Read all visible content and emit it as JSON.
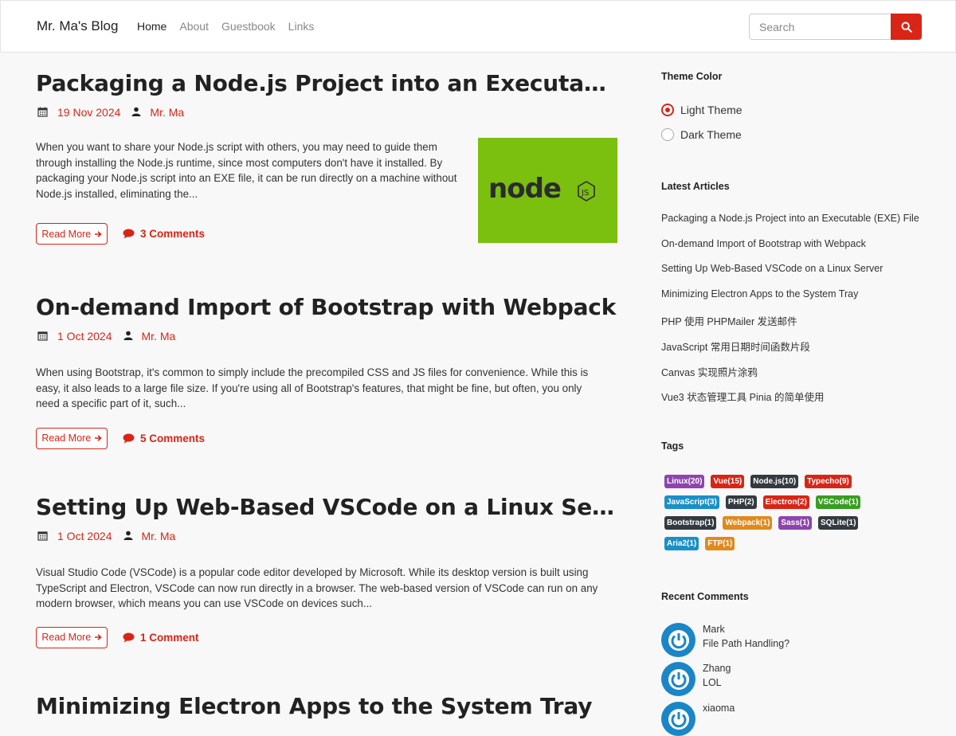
{
  "nav": {
    "brand": "Mr. Ma's Blog",
    "links": [
      "Home",
      "About",
      "Guestbook",
      "Links"
    ],
    "search_placeholder": "Search"
  },
  "articles": [
    {
      "title": "Packaging a Node.js Project into an Executable (EXE) File",
      "date": "19 Nov 2024",
      "author": "Mr. Ma",
      "excerpt": "When you want to share your Node.js script with others, you may need to guide them through installing the Node.js runtime, since most computers don't have it installed. By packaging your Node.js script into an EXE file, it can be run directly on a machine without Node.js installed, eliminating the...",
      "read_more": "Read More",
      "comments": "3 Comments",
      "thumbnail_text": "node",
      "thumbnail_badge": "JS"
    },
    {
      "title": "On-demand Import of Bootstrap with Webpack",
      "date": "1 Oct 2024",
      "author": "Mr. Ma",
      "excerpt": "When using Bootstrap, it's common to simply include the precompiled CSS and JS files for convenience. While this is easy, it also leads to a large file size. If you're using all of Bootstrap's features, that might be fine, but often, you only need a specific part of it, such...",
      "read_more": "Read More",
      "comments": "5 Comments"
    },
    {
      "title": "Setting Up Web-Based VSCode on a Linux Server",
      "date": "1 Oct 2024",
      "author": "Mr. Ma",
      "excerpt": "Visual Studio Code (VSCode) is a popular code editor developed by Microsoft. While its desktop version is built using TypeScript and Electron, VSCode can now run directly in a browser. The web-based version of VSCode can run on any modern browser, which means you can use VSCode on devices such...",
      "read_more": "Read More",
      "comments": "1 Comment"
    },
    {
      "title": "Minimizing Electron Apps to the System Tray"
    }
  ],
  "sidebar": {
    "theme_heading": "Theme Color",
    "theme_options": [
      "Light Theme",
      "Dark Theme"
    ],
    "latest_heading": "Latest Articles",
    "latest": [
      "Packaging a Node.js Project into an Executable (EXE) File",
      "On-demand Import of Bootstrap with Webpack",
      "Setting Up Web-Based VSCode on a Linux Server",
      "Minimizing Electron Apps to the System Tray",
      "PHP 使用 PHPMailer 发送邮件",
      "JavaScript 常用日期时间函数片段",
      "Canvas 实现照片涂鸦",
      "Vue3 状态管理工具 Pinia 的简单使用"
    ],
    "tags_heading": "Tags",
    "tags": [
      {
        "label": "Linux(20)",
        "color": "#8e44ad"
      },
      {
        "label": "Vue(15)",
        "color": "#d92516"
      },
      {
        "label": "Node.js(10)",
        "color": "#333a40"
      },
      {
        "label": "Typecho(9)",
        "color": "#d92516"
      },
      {
        "label": "JavaScript(3)",
        "color": "#1a8fc8"
      },
      {
        "label": "PHP(2)",
        "color": "#333a40"
      },
      {
        "label": "Electron(2)",
        "color": "#d92516"
      },
      {
        "label": "VSCode(1)",
        "color": "#3a9d23"
      },
      {
        "label": "Bootstrap(1)",
        "color": "#333a40"
      },
      {
        "label": "Webpack(1)",
        "color": "#e08a1e"
      },
      {
        "label": "Sass(1)",
        "color": "#8e44ad"
      },
      {
        "label": "SQLite(1)",
        "color": "#333a40"
      },
      {
        "label": "Aria2(1)",
        "color": "#1a8fc8"
      },
      {
        "label": "FTP(1)",
        "color": "#e08a1e"
      }
    ],
    "comments_heading": "Recent Comments",
    "recent_comments": [
      {
        "name": "Mark",
        "text": "File Path Handling?"
      },
      {
        "name": "Zhang",
        "text": "LOL"
      },
      {
        "name": "xiaoma",
        "text": ""
      }
    ]
  },
  "colors": {
    "accent": "#d92516",
    "node_green": "#7bbf0f"
  }
}
